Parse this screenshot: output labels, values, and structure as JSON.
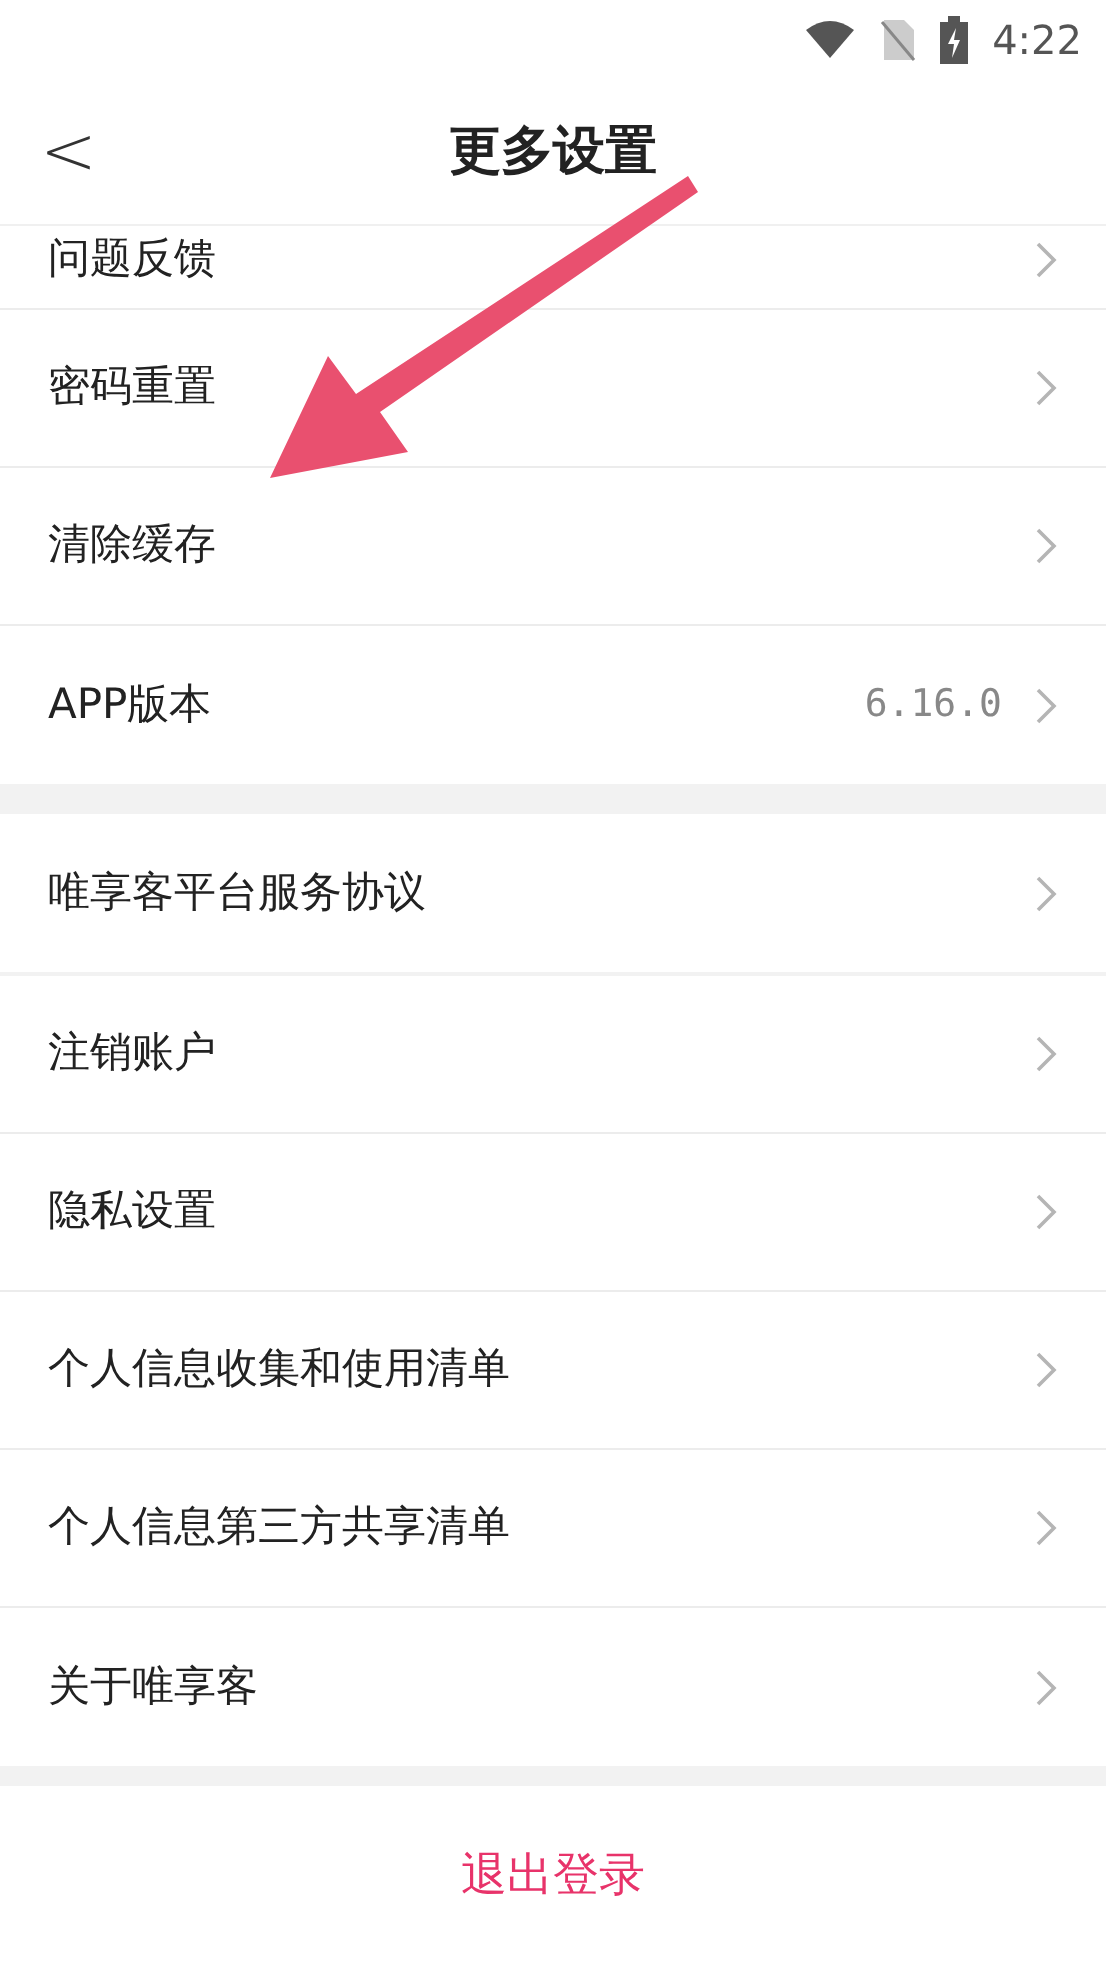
{
  "status_bar": {
    "time": "4:22"
  },
  "header": {
    "back": "<",
    "title": "更多设置"
  },
  "groups": [
    {
      "items": [
        {
          "label": "问题反馈"
        },
        {
          "label": "密码重置"
        },
        {
          "label": "清除缓存"
        },
        {
          "label": "APP版本",
          "value": "6.16.0"
        }
      ]
    },
    {
      "items": [
        {
          "label": "唯享客平台服务协议"
        }
      ]
    },
    {
      "items": [
        {
          "label": "注销账户"
        },
        {
          "label": "隐私设置"
        },
        {
          "label": "个人信息收集和使用清单"
        },
        {
          "label": "个人信息第三方共享清单"
        },
        {
          "label": "关于唯享客"
        }
      ]
    }
  ],
  "logout": "退出登录"
}
